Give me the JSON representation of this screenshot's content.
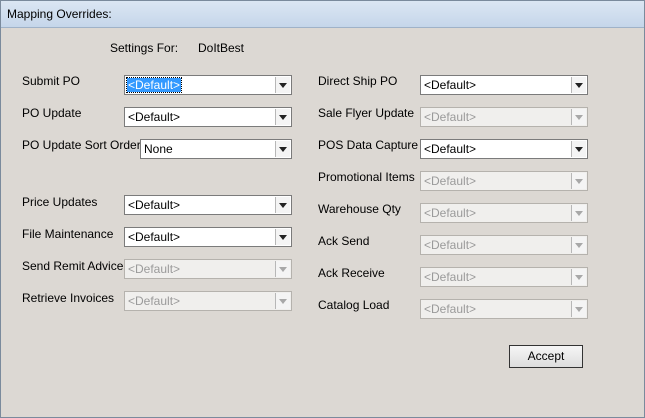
{
  "window": {
    "title": "Mapping Overrides:"
  },
  "settings": {
    "label": "Settings For:",
    "value": "DoItBest"
  },
  "left": [
    {
      "label": "Submit PO",
      "value": "<Default>",
      "enabled": true,
      "selected": true
    },
    {
      "label": "PO Update",
      "value": "<Default>",
      "enabled": true
    },
    {
      "label": "PO Update Sort Order:",
      "value": "None",
      "enabled": true
    },
    {
      "label": "Price Updates",
      "value": "<Default>",
      "enabled": true
    },
    {
      "label": "File Maintenance",
      "value": "<Default>",
      "enabled": true
    },
    {
      "label": "Send Remit Advice",
      "value": "<Default>",
      "enabled": false
    },
    {
      "label": "Retrieve Invoices",
      "value": "<Default>",
      "enabled": false
    }
  ],
  "right": [
    {
      "label": "Direct Ship PO",
      "value": "<Default>",
      "enabled": true
    },
    {
      "label": "Sale Flyer Update",
      "value": "<Default>",
      "enabled": false
    },
    {
      "label": "POS Data Capture",
      "value": "<Default>",
      "enabled": true
    },
    {
      "label": "Promotional Items",
      "value": "<Default>",
      "enabled": false
    },
    {
      "label": "Warehouse Qty",
      "value": "<Default>",
      "enabled": false
    },
    {
      "label": "Ack Send",
      "value": "<Default>",
      "enabled": false
    },
    {
      "label": "Ack Receive",
      "value": "<Default>",
      "enabled": false
    },
    {
      "label": "Catalog Load",
      "value": "<Default>",
      "enabled": false
    }
  ],
  "accept_label": "Accept"
}
